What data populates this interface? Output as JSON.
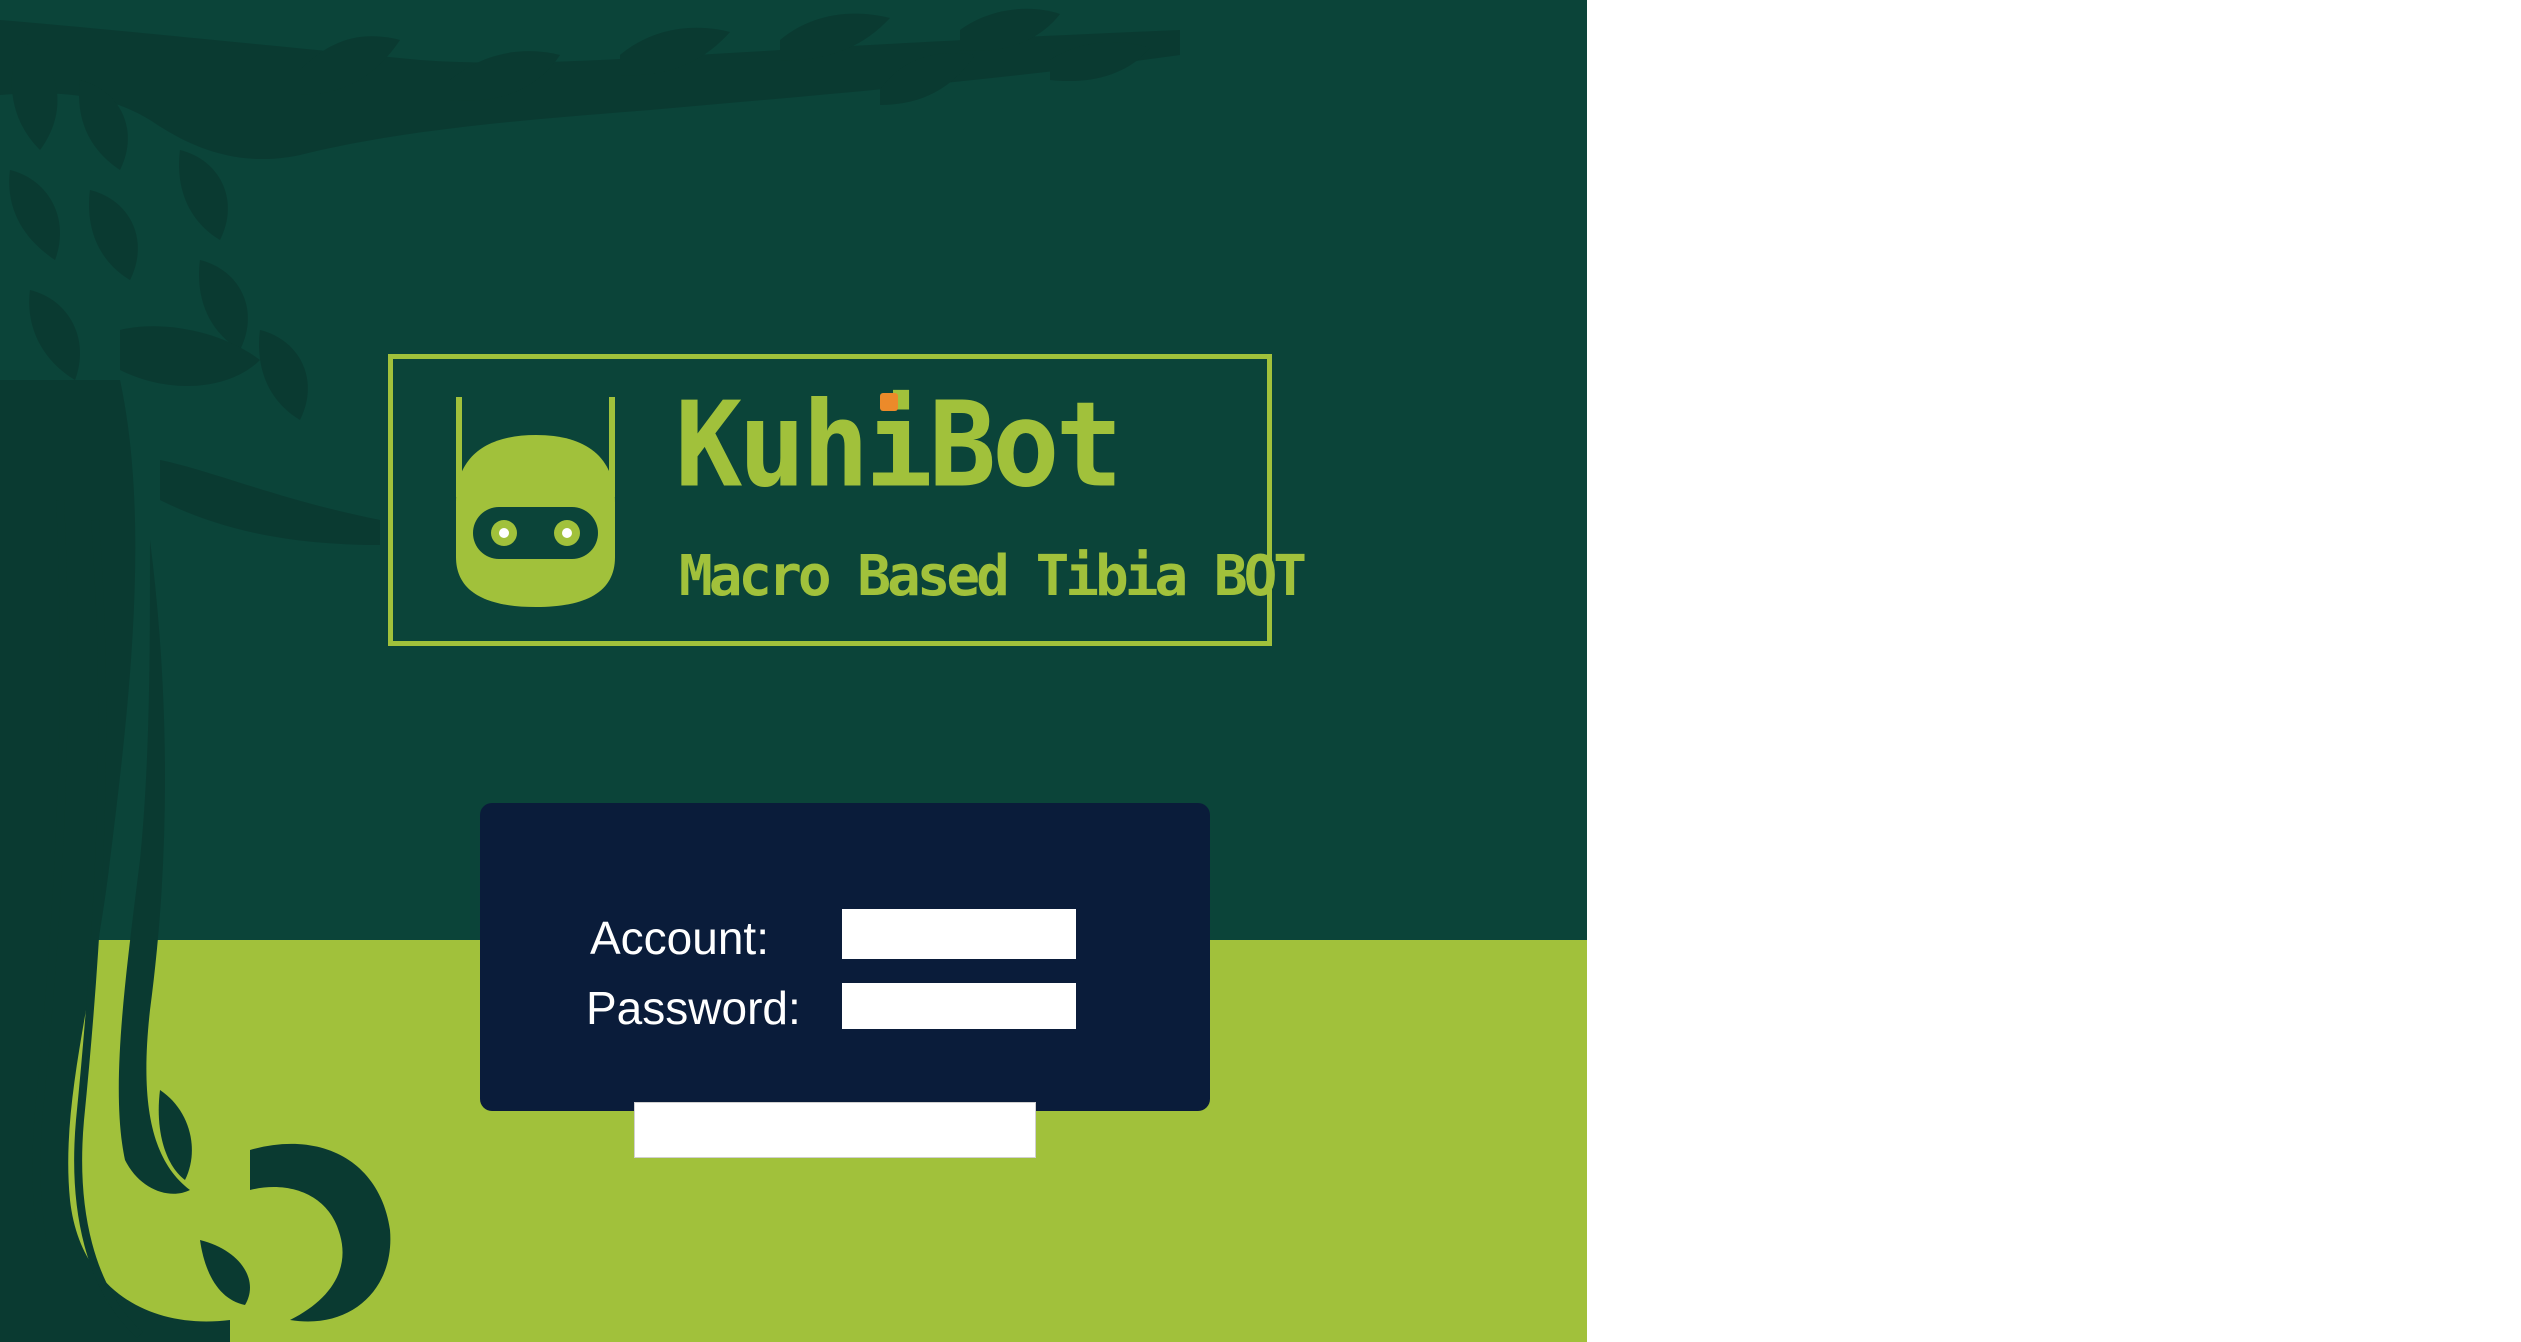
{
  "brand": {
    "name": "KuhiBot",
    "tagline": "Macro Based Tibia BOT",
    "logo_icon": "robot-icon"
  },
  "login": {
    "account_label": "Account:",
    "account_value": "",
    "password_label": "Password:",
    "password_value": "",
    "submit_label": ""
  },
  "colors": {
    "dark_green": "#0b4439",
    "lime_green": "#a1c13b",
    "panel_navy": "#0a1c3a",
    "accent_orange": "#ec8a2a"
  }
}
